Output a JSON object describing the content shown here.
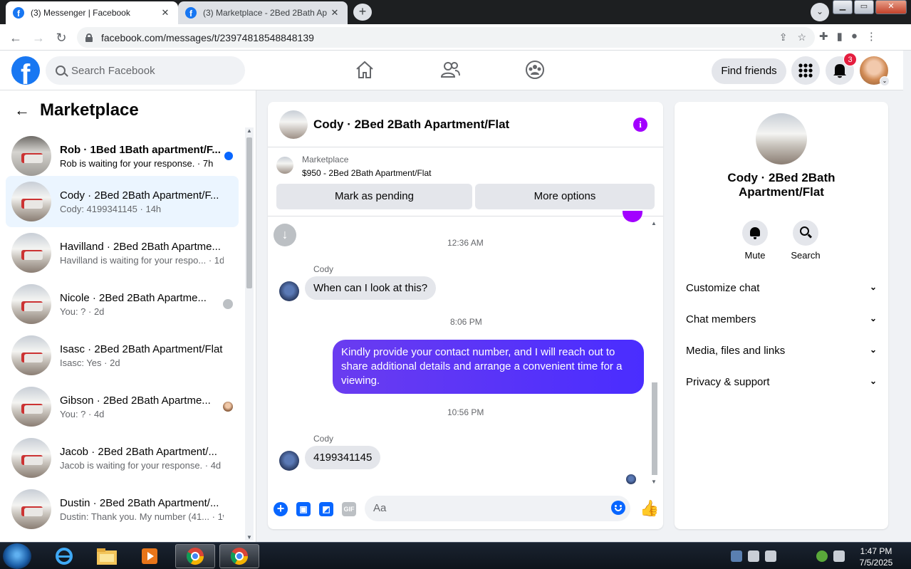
{
  "browser": {
    "tabs": [
      {
        "title": "(3) Messenger | Facebook",
        "active": true
      },
      {
        "title": "(3) Marketplace - 2Bed 2Bath Ap",
        "active": false
      }
    ],
    "url": "facebook.com/messages/t/23974818548848139"
  },
  "header": {
    "search_placeholder": "Search Facebook",
    "find_friends_label": "Find friends",
    "notification_count": "3"
  },
  "sidebar": {
    "title": "Marketplace",
    "conversations": [
      {
        "name": "Rob · 1Bed 1Bath apartment/F...",
        "preview": "Rob is waiting for your response. · 7h",
        "indicator": "unread-dot"
      },
      {
        "name": "Cody · 2Bed 2Bath Apartment/F...",
        "preview": "Cody: 4199341145 · 14h",
        "indicator": "none",
        "selected": true
      },
      {
        "name": "Havilland · 2Bed 2Bath Apartme...",
        "preview": "Havilland is waiting for your respo... · 1d",
        "indicator": "none"
      },
      {
        "name": "Nicole · 2Bed 2Bath Apartme...",
        "preview": "You: ? · 2d",
        "indicator": "seen-avatar"
      },
      {
        "name": "Isasc · 2Bed 2Bath Apartment/Flat",
        "preview": "Isasc: Yes · 2d",
        "indicator": "none"
      },
      {
        "name": "Gibson · 2Bed 2Bath Apartme...",
        "preview": "You: ? · 4d",
        "indicator": "seen-photo"
      },
      {
        "name": "Jacob · 2Bed 2Bath Apartment/...",
        "preview": "Jacob is waiting for your response. · 4d",
        "indicator": "none"
      },
      {
        "name": "Dustin · 2Bed 2Bath Apartment/...",
        "preview": "Dustin: Thank you. My number (41... · 1w",
        "indicator": "none"
      }
    ]
  },
  "chat": {
    "title": "Cody · 2Bed 2Bath Apartment/Flat",
    "marketplace_label": "Marketplace",
    "listing": "$950 - 2Bed 2Bath Apartment/Flat",
    "mark_pending_label": "Mark as pending",
    "more_options_label": "More options",
    "messages": [
      {
        "timestamp": "12:36 AM",
        "sender": "Cody",
        "text": "When can I look at this?"
      },
      {
        "timestamp": "8:06 PM",
        "sender": "me",
        "text": "Kindly provide your contact number, and I will reach out to share additional details and arrange a convenient time for a viewing."
      },
      {
        "timestamp": "10:56 PM",
        "sender": "Cody",
        "text": "4199341145"
      }
    ],
    "composer_placeholder": "Aa"
  },
  "info_panel": {
    "name": "Cody · 2Bed 2Bath Apartment/Flat",
    "mute_label": "Mute",
    "search_label": "Search",
    "sections": [
      "Customize chat",
      "Chat members",
      "Media, files and links",
      "Privacy & support"
    ]
  },
  "taskbar": {
    "time": "1:47 PM",
    "date": "7/5/2025"
  },
  "colors": {
    "brand": "#1877f2",
    "accent_purple": "#a200ff",
    "outgoing_bubble": "#4a2dff",
    "selected_row": "#ebf5ff"
  }
}
